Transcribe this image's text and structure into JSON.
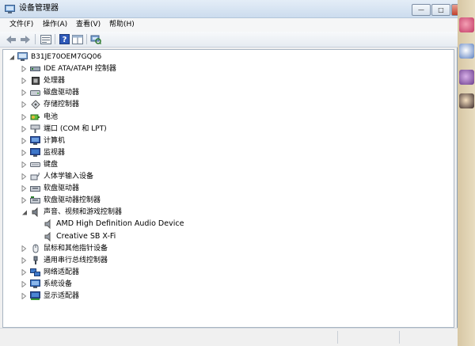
{
  "window": {
    "title": "设备管理器",
    "buttons": {
      "minimize": "—",
      "maximize": "□",
      "close": "✕"
    }
  },
  "menu": [
    {
      "label": "文件(F)"
    },
    {
      "label": "操作(A)"
    },
    {
      "label": "查看(V)"
    },
    {
      "label": "帮助(H)"
    }
  ],
  "toolbar": {
    "icons": [
      "back-arrow-icon",
      "forward-arrow-icon",
      "properties-icon",
      "help-icon",
      "grid-icon",
      "scan-hardware-icon"
    ]
  },
  "tree": {
    "root": "B31JE70OEM7GQ06",
    "categories": [
      {
        "label": "IDE ATA/ATAPI 控制器",
        "icon": "ide-controller-icon"
      },
      {
        "label": "处理器",
        "icon": "processor-icon"
      },
      {
        "label": "磁盘驱动器",
        "icon": "disk-drive-icon"
      },
      {
        "label": "存储控制器",
        "icon": "storage-controller-icon"
      },
      {
        "label": "电池",
        "icon": "battery-icon"
      },
      {
        "label": "端口 (COM 和 LPT)",
        "icon": "port-icon"
      },
      {
        "label": "计算机",
        "icon": "computer-icon"
      },
      {
        "label": "监视器",
        "icon": "monitor-icon"
      },
      {
        "label": "键盘",
        "icon": "keyboard-icon"
      },
      {
        "label": "人体学输入设备",
        "icon": "hid-icon"
      },
      {
        "label": "软盘驱动器",
        "icon": "floppy-drive-icon"
      },
      {
        "label": "软盘驱动器控制器",
        "icon": "floppy-controller-icon"
      },
      {
        "label": "声音、视频和游戏控制器",
        "icon": "sound-icon",
        "expanded": true,
        "children": [
          {
            "label": "AMD High Definition Audio Device"
          },
          {
            "label": "Creative SB X-Fi"
          }
        ]
      },
      {
        "label": "鼠标和其他指针设备",
        "icon": "mouse-icon"
      },
      {
        "label": "通用串行总线控制器",
        "icon": "usb-icon"
      },
      {
        "label": "网络适配器",
        "icon": "network-adapter-icon"
      },
      {
        "label": "系统设备",
        "icon": "system-device-icon"
      },
      {
        "label": "显示适配器",
        "icon": "display-adapter-icon"
      }
    ]
  }
}
